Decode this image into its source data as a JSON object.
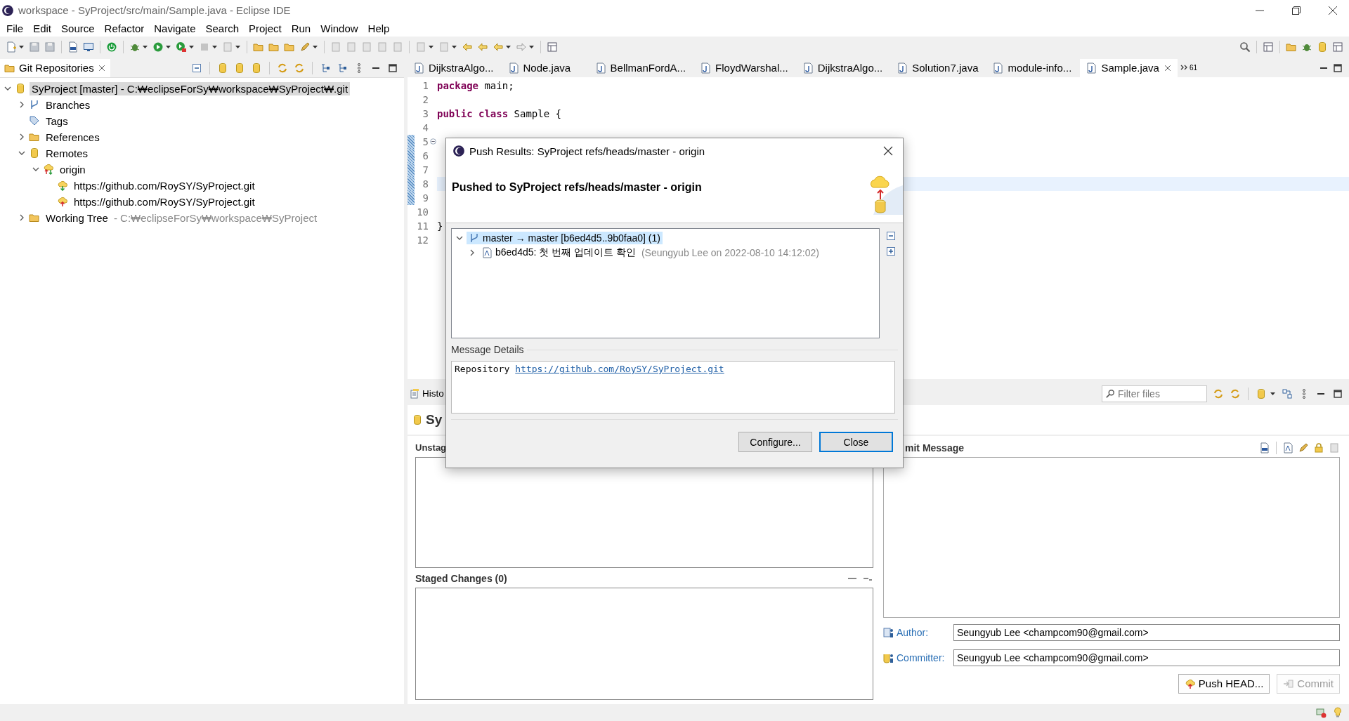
{
  "window": {
    "title": "workspace - SyProject/src/main/Sample.java - Eclipse IDE"
  },
  "menu": [
    "File",
    "Edit",
    "Source",
    "Refactor",
    "Navigate",
    "Search",
    "Project",
    "Run",
    "Window",
    "Help"
  ],
  "repositories": {
    "tab": "Git Repositories",
    "tree": [
      {
        "label": "SyProject [master] - C:₩eclipseForSy₩workspace₩SyProject₩.git",
        "kind": "repo",
        "expanded": true,
        "selected": true,
        "children": [
          {
            "label": "Branches",
            "kind": "branches",
            "expanded": false,
            "selected": false
          },
          {
            "label": "Tags",
            "kind": "tags",
            "selected": false
          },
          {
            "label": "References",
            "kind": "folder",
            "expanded": false,
            "selected": false
          },
          {
            "label": "Remotes",
            "kind": "remotes",
            "expanded": true,
            "selected": false,
            "children": [
              {
                "label": "origin",
                "kind": "remote",
                "expanded": true,
                "selected": false,
                "children": [
                  {
                    "label": "https://github.com/RoySY/SyProject.git",
                    "kind": "fetch",
                    "selected": false
                  },
                  {
                    "label": "https://github.com/RoySY/SyProject.git",
                    "kind": "push",
                    "selected": false
                  }
                ]
              }
            ]
          },
          {
            "label": "Working Tree",
            "detail": "- C:₩eclipseForSy₩workspace₩SyProject",
            "kind": "folder",
            "expanded": false,
            "selected": false
          }
        ]
      }
    ]
  },
  "editor_tabs": [
    {
      "label": "DijkstraAlgo...",
      "selected": false
    },
    {
      "label": "Node.java",
      "selected": false
    },
    {
      "label": "BellmanFordA...",
      "selected": false
    },
    {
      "label": "FloydWarshal...",
      "selected": false
    },
    {
      "label": "DijkstraAlgo...",
      "selected": false
    },
    {
      "label": "Solution7.java",
      "selected": false
    },
    {
      "label": "module-info...",
      "selected": false
    },
    {
      "label": "Sample.java",
      "selected": true
    }
  ],
  "editor_overflow": "61",
  "code": [
    {
      "number": "1",
      "tokens": [
        {
          "kind": "keyword",
          "text": "package"
        },
        {
          "kind": "plain",
          "text": " main;"
        }
      ],
      "current": false,
      "changed": false,
      "fold": false
    },
    {
      "number": "2",
      "current": false,
      "changed": false,
      "fold": false
    },
    {
      "number": "3",
      "tokens": [
        {
          "kind": "keyword",
          "text": "public"
        },
        {
          "kind": "keyword",
          "text": " class"
        },
        {
          "kind": "plain",
          "text": " Sample {"
        }
      ],
      "current": false,
      "changed": false,
      "fold": false
    },
    {
      "number": "4",
      "current": false,
      "changed": false,
      "fold": false
    },
    {
      "number": "5",
      "current": false,
      "changed": true,
      "fold": true
    },
    {
      "number": "6",
      "current": false,
      "changed": true,
      "fold": false
    },
    {
      "number": "7",
      "current": false,
      "changed": true,
      "fold": false
    },
    {
      "number": "8",
      "current": true,
      "changed": true,
      "fold": false
    },
    {
      "number": "9",
      "current": false,
      "changed": true,
      "fold": false
    },
    {
      "number": "10",
      "current": false,
      "changed": false,
      "fold": false
    },
    {
      "number": "11",
      "tokens": [
        {
          "kind": "plain",
          "text": "}"
        }
      ],
      "current": false,
      "changed": false,
      "fold": false
    },
    {
      "number": "12",
      "current": false,
      "changed": false,
      "fold": false
    }
  ],
  "staging": {
    "tab": "Histo",
    "title": "Sy",
    "unstaged_label": "Unstag",
    "staged_label": "Staged Changes (0)",
    "commit_label": "mit Message",
    "filter": {
      "placeholder": "Filter files"
    },
    "author": {
      "label": "Author:",
      "value": "Seungyub Lee <champcom90@gmail.com>"
    },
    "committer": {
      "label": "Committer:",
      "value": "Seungyub Lee <champcom90@gmail.com>"
    },
    "buttons": [
      {
        "label": "Push HEAD...",
        "disabled": false
      },
      {
        "label": "Commit",
        "disabled": true
      }
    ]
  },
  "dialog": {
    "title": "Push Results: SyProject refs/heads/master - origin",
    "heading": "Pushed to SyProject refs/heads/master - origin",
    "tree": [
      {
        "label": "master → master [b6ed4d5..9b0faa0] (1)",
        "kind": "branch",
        "expanded": true,
        "selected": true,
        "children": [
          {
            "label": "b6ed4d5: 첫 번째 업데이트 확인",
            "detail": "(Seungyub Lee on 2022-08-10 14:12:02)",
            "kind": "commit",
            "expanded": false,
            "selected": false
          }
        ]
      }
    ],
    "details_label": "Message Details",
    "details": {
      "text": "Repository",
      "link": "https://github.com/RoySY/SyProject.git"
    },
    "buttons": [
      {
        "label": "Configure...",
        "default": false
      },
      {
        "label": "Close",
        "default": true
      }
    ]
  }
}
